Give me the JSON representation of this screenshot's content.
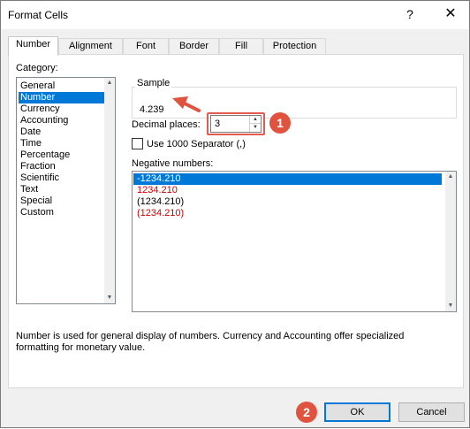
{
  "window": {
    "title": "Format Cells",
    "help_glyph": "?",
    "close_glyph": "✕"
  },
  "tabs": [
    {
      "label": "Number",
      "active": true
    },
    {
      "label": "Alignment"
    },
    {
      "label": "Font"
    },
    {
      "label": "Border"
    },
    {
      "label": "Fill"
    },
    {
      "label": "Protection"
    }
  ],
  "category": {
    "label": "Category:",
    "selected": "Number",
    "items": [
      "General",
      "Number",
      "Currency",
      "Accounting",
      "Date",
      "Time",
      "Percentage",
      "Fraction",
      "Scientific",
      "Text",
      "Special",
      "Custom"
    ]
  },
  "sample": {
    "legend": "Sample",
    "value": "4.239"
  },
  "decimal_places": {
    "label": "Decimal places:",
    "value": "3"
  },
  "separator": {
    "label": "Use 1000 Separator (,)",
    "checked": false
  },
  "negative_numbers": {
    "label": "Negative numbers:",
    "items": [
      {
        "text": "-1234.210",
        "color": "#ffffff",
        "selected": true
      },
      {
        "text": "1234.210",
        "color": "#d40000"
      },
      {
        "text": "(1234.210)",
        "color": "#000000"
      },
      {
        "text": "(1234.210)",
        "color": "#d40000"
      }
    ]
  },
  "description": "Number is used for general display of numbers.  Currency and Accounting offer specialized formatting for monetary value.",
  "buttons": {
    "ok": "OK",
    "cancel": "Cancel"
  },
  "annotations": {
    "step1": "1",
    "step2": "2",
    "accent": "#e0533f"
  },
  "colors": {
    "selection": "#0078d7",
    "negative_red": "#d40000"
  }
}
